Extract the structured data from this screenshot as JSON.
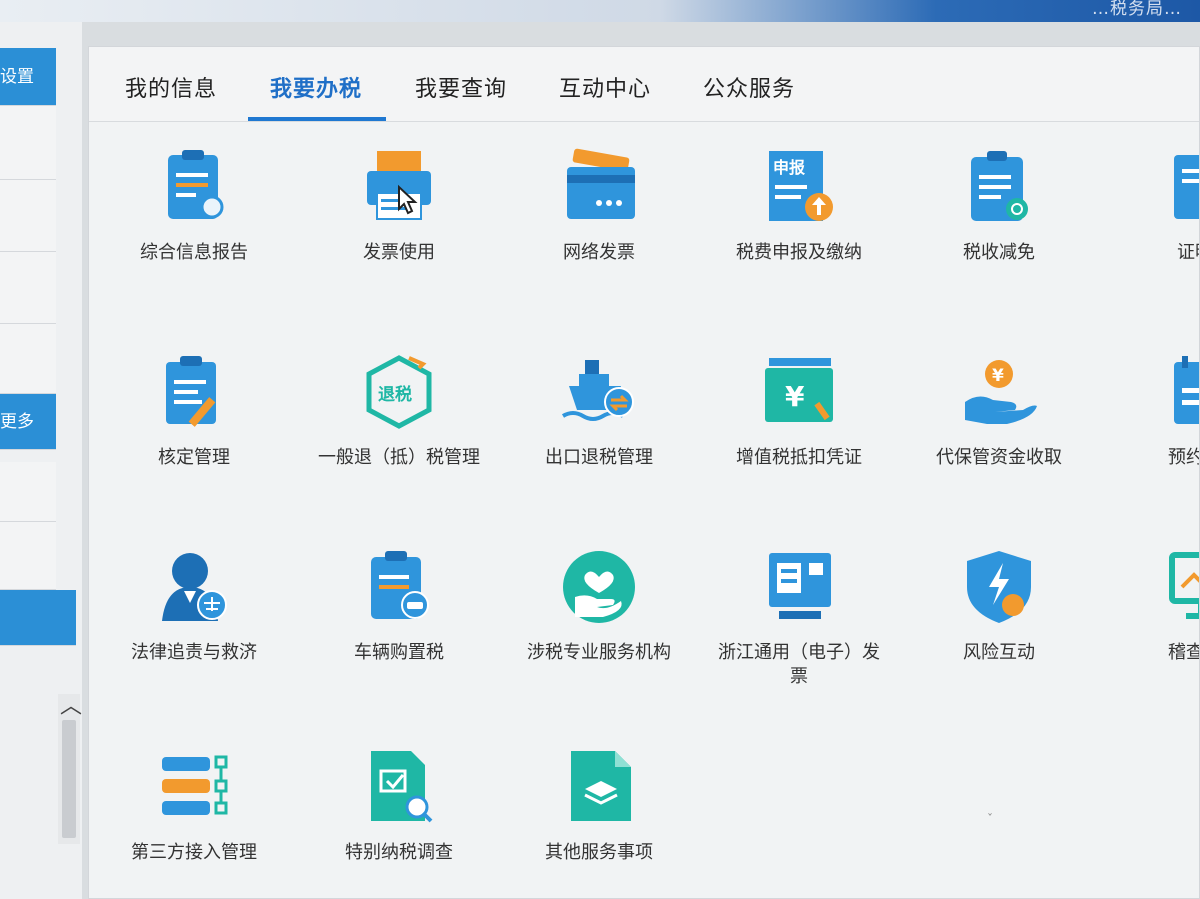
{
  "header": {
    "text": "…税务局…"
  },
  "sidebar": {
    "items": [
      {
        "label": "设置",
        "style": "blue"
      },
      {
        "label": "",
        "style": "plain"
      },
      {
        "label": "",
        "style": "plain"
      },
      {
        "label": "",
        "style": "plain"
      },
      {
        "label": "",
        "style": "plain"
      },
      {
        "label": "更多",
        "style": "blue"
      },
      {
        "label": "",
        "style": "plain"
      },
      {
        "label": "",
        "style": "plain"
      },
      {
        "label": "",
        "style": "blue"
      }
    ]
  },
  "tabs": [
    {
      "label": "我的信息",
      "active": false
    },
    {
      "label": "我要办税",
      "active": true
    },
    {
      "label": "我要查询",
      "active": false
    },
    {
      "label": "互动中心",
      "active": false
    },
    {
      "label": "公众服务",
      "active": false
    }
  ],
  "services": [
    {
      "label": "综合信息报告",
      "icon": "clipboard-mic-icon"
    },
    {
      "label": "发票使用",
      "icon": "printer-icon"
    },
    {
      "label": "网络发票",
      "icon": "wallet-card-icon"
    },
    {
      "label": "税费申报及缴纳",
      "icon": "declare-upload-icon",
      "badge": "申报"
    },
    {
      "label": "税收减免",
      "icon": "clipboard-clock-icon"
    },
    {
      "label": "证明开",
      "icon": "certificate-icon"
    },
    {
      "label": "核定管理",
      "icon": "clipboard-pen-icon"
    },
    {
      "label": "一般退（抵）税管理",
      "icon": "refund-hexagon-icon",
      "badge": "退税"
    },
    {
      "label": "出口退税管理",
      "icon": "ship-icon"
    },
    {
      "label": "增值税抵扣凭证",
      "icon": "yen-ticket-icon",
      "badge": "¥"
    },
    {
      "label": "代保管资金收取",
      "icon": "hand-coin-icon",
      "badge": "¥"
    },
    {
      "label": "预约定价",
      "icon": "calendar-icon"
    },
    {
      "label": "法律追责与救济",
      "icon": "judge-icon"
    },
    {
      "label": "车辆购置税",
      "icon": "clipboard-car-icon"
    },
    {
      "label": "涉税专业服务机构",
      "icon": "heart-hand-icon"
    },
    {
      "label": "浙江通用（电子）发票",
      "icon": "terminal-icon"
    },
    {
      "label": "风险互动",
      "icon": "shield-bolt-icon"
    },
    {
      "label": "稽查检查",
      "icon": "monitor-chart-icon"
    },
    {
      "label": "第三方接入管理",
      "icon": "server-link-icon"
    },
    {
      "label": "特别纳税调查",
      "icon": "doc-search-icon"
    },
    {
      "label": "其他服务事项",
      "icon": "layers-doc-icon"
    }
  ],
  "colors": {
    "accent": "#1f78d1",
    "icon_blue": "#2f95dc",
    "icon_teal": "#1fb7a5",
    "icon_orange": "#f29a2e"
  }
}
